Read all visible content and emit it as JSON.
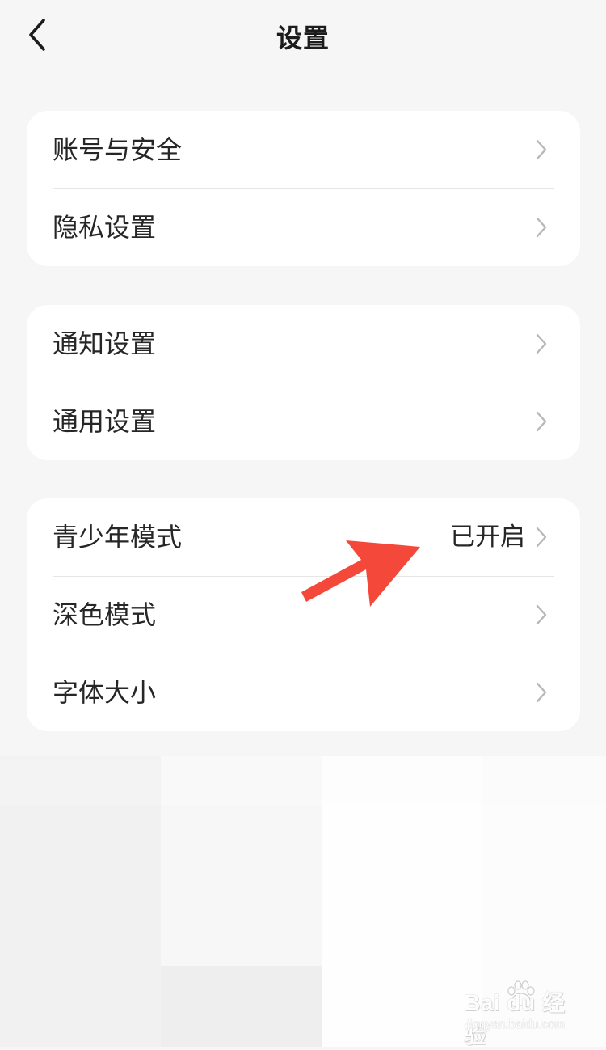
{
  "header": {
    "title": "设置",
    "back_icon": "chevron-left-icon"
  },
  "groups": [
    {
      "items": [
        {
          "label": "账号与安全",
          "value": ""
        },
        {
          "label": "隐私设置",
          "value": ""
        }
      ]
    },
    {
      "items": [
        {
          "label": "通知设置",
          "value": ""
        },
        {
          "label": "通用设置",
          "value": ""
        }
      ]
    },
    {
      "items": [
        {
          "label": "青少年模式",
          "value": "已开启"
        },
        {
          "label": "深色模式",
          "value": ""
        },
        {
          "label": "字体大小",
          "value": ""
        }
      ]
    }
  ],
  "annotation": {
    "arrow_color": "#f4493a",
    "arrow_icon": "red-arrow-annotation"
  },
  "watermark": {
    "brand": "Bai du 经验",
    "url": "jingyan.baidu.com"
  },
  "colors": {
    "background": "#f6f6f6",
    "card": "#ffffff",
    "text": "#262626",
    "chevron": "#b8b8b8",
    "divider": "#e6e6e6"
  }
}
